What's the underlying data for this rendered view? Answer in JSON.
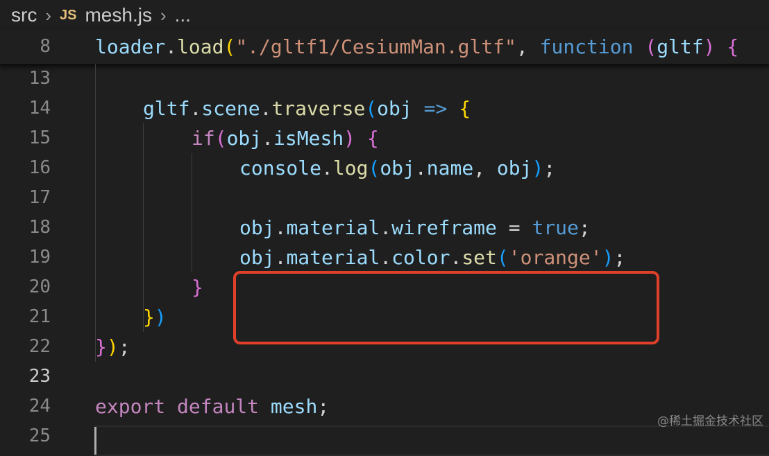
{
  "breadcrumb": {
    "folder": "src",
    "file_icon": "JS",
    "file": "mesh.js",
    "more": "..."
  },
  "sticky": {
    "line_number": "8",
    "tokens": [
      {
        "text": "loader",
        "cls": "c-var"
      },
      {
        "text": ".",
        "cls": "c-pl"
      },
      {
        "text": "load",
        "cls": "c-fn"
      },
      {
        "text": "(",
        "cls": "c-p1"
      },
      {
        "text": "\"./gltf1/CesiumMan.gltf\"",
        "cls": "c-str"
      },
      {
        "text": ", ",
        "cls": "c-pl"
      },
      {
        "text": "function",
        "cls": "c-kw"
      },
      {
        "text": " ",
        "cls": "c-pl"
      },
      {
        "text": "(",
        "cls": "c-p2"
      },
      {
        "text": "gltf",
        "cls": "c-var"
      },
      {
        "text": ")",
        "cls": "c-p2"
      },
      {
        "text": " ",
        "cls": "c-pl"
      },
      {
        "text": "{",
        "cls": "c-p2"
      }
    ]
  },
  "lines": [
    {
      "n": "13",
      "tokens": []
    },
    {
      "n": "14",
      "tokens": [
        {
          "text": "gltf",
          "cls": "c-var"
        },
        {
          "text": ".",
          "cls": "c-pl"
        },
        {
          "text": "scene",
          "cls": "c-var"
        },
        {
          "text": ".",
          "cls": "c-pl"
        },
        {
          "text": "traverse",
          "cls": "c-fn"
        },
        {
          "text": "(",
          "cls": "c-p3"
        },
        {
          "text": "obj",
          "cls": "c-var"
        },
        {
          "text": " ",
          "cls": "c-pl"
        },
        {
          "text": "=>",
          "cls": "c-kw"
        },
        {
          "text": " ",
          "cls": "c-pl"
        },
        {
          "text": "{",
          "cls": "c-p1"
        }
      ]
    },
    {
      "n": "15",
      "tokens": [
        {
          "text": "if",
          "cls": "c-ctl"
        },
        {
          "text": "(",
          "cls": "c-p2"
        },
        {
          "text": "obj",
          "cls": "c-var"
        },
        {
          "text": ".",
          "cls": "c-pl"
        },
        {
          "text": "isMesh",
          "cls": "c-var"
        },
        {
          "text": ")",
          "cls": "c-p2"
        },
        {
          "text": " ",
          "cls": "c-pl"
        },
        {
          "text": "{",
          "cls": "c-p2"
        }
      ]
    },
    {
      "n": "16",
      "tokens": [
        {
          "text": "console",
          "cls": "c-var"
        },
        {
          "text": ".",
          "cls": "c-pl"
        },
        {
          "text": "log",
          "cls": "c-fn"
        },
        {
          "text": "(",
          "cls": "c-p3"
        },
        {
          "text": "obj",
          "cls": "c-var"
        },
        {
          "text": ".",
          "cls": "c-pl"
        },
        {
          "text": "name",
          "cls": "c-var"
        },
        {
          "text": ", ",
          "cls": "c-pl"
        },
        {
          "text": "obj",
          "cls": "c-var"
        },
        {
          "text": ")",
          "cls": "c-p3"
        },
        {
          "text": ";",
          "cls": "c-pl"
        }
      ]
    },
    {
      "n": "17",
      "tokens": []
    },
    {
      "n": "18",
      "tokens": [
        {
          "text": "obj",
          "cls": "c-var"
        },
        {
          "text": ".",
          "cls": "c-pl"
        },
        {
          "text": "material",
          "cls": "c-var"
        },
        {
          "text": ".",
          "cls": "c-pl"
        },
        {
          "text": "wireframe",
          "cls": "c-var"
        },
        {
          "text": " = ",
          "cls": "c-pl"
        },
        {
          "text": "true",
          "cls": "c-bool"
        },
        {
          "text": ";",
          "cls": "c-pl"
        }
      ]
    },
    {
      "n": "19",
      "tokens": [
        {
          "text": "obj",
          "cls": "c-var"
        },
        {
          "text": ".",
          "cls": "c-pl"
        },
        {
          "text": "material",
          "cls": "c-var"
        },
        {
          "text": ".",
          "cls": "c-pl"
        },
        {
          "text": "color",
          "cls": "c-var"
        },
        {
          "text": ".",
          "cls": "c-pl"
        },
        {
          "text": "set",
          "cls": "c-fn"
        },
        {
          "text": "(",
          "cls": "c-p3"
        },
        {
          "text": "'orange'",
          "cls": "c-str"
        },
        {
          "text": ")",
          "cls": "c-p3"
        },
        {
          "text": ";",
          "cls": "c-pl"
        }
      ]
    },
    {
      "n": "20",
      "tokens": [
        {
          "text": "}",
          "cls": "c-p2"
        }
      ]
    },
    {
      "n": "21",
      "tokens": [
        {
          "text": "}",
          "cls": "c-p1"
        },
        {
          "text": ")",
          "cls": "c-p3"
        }
      ]
    },
    {
      "n": "22",
      "tokens": [
        {
          "text": "}",
          "cls": "c-p2"
        },
        {
          "text": ")",
          "cls": "c-p1"
        },
        {
          "text": ";",
          "cls": "c-pl"
        }
      ]
    },
    {
      "n": "23",
      "tokens": [],
      "current": true
    },
    {
      "n": "24",
      "tokens": [
        {
          "text": "export",
          "cls": "c-ctl"
        },
        {
          "text": " ",
          "cls": "c-pl"
        },
        {
          "text": "default",
          "cls": "c-ctl"
        },
        {
          "text": " ",
          "cls": "c-pl"
        },
        {
          "text": "mesh",
          "cls": "c-var"
        },
        {
          "text": ";",
          "cls": "c-pl"
        }
      ]
    },
    {
      "n": "25",
      "tokens": []
    }
  ],
  "watermark": "@稀土掘金技术社区",
  "colors": {
    "highlight_box": "#e0402a",
    "background": "#1f1f1f"
  }
}
